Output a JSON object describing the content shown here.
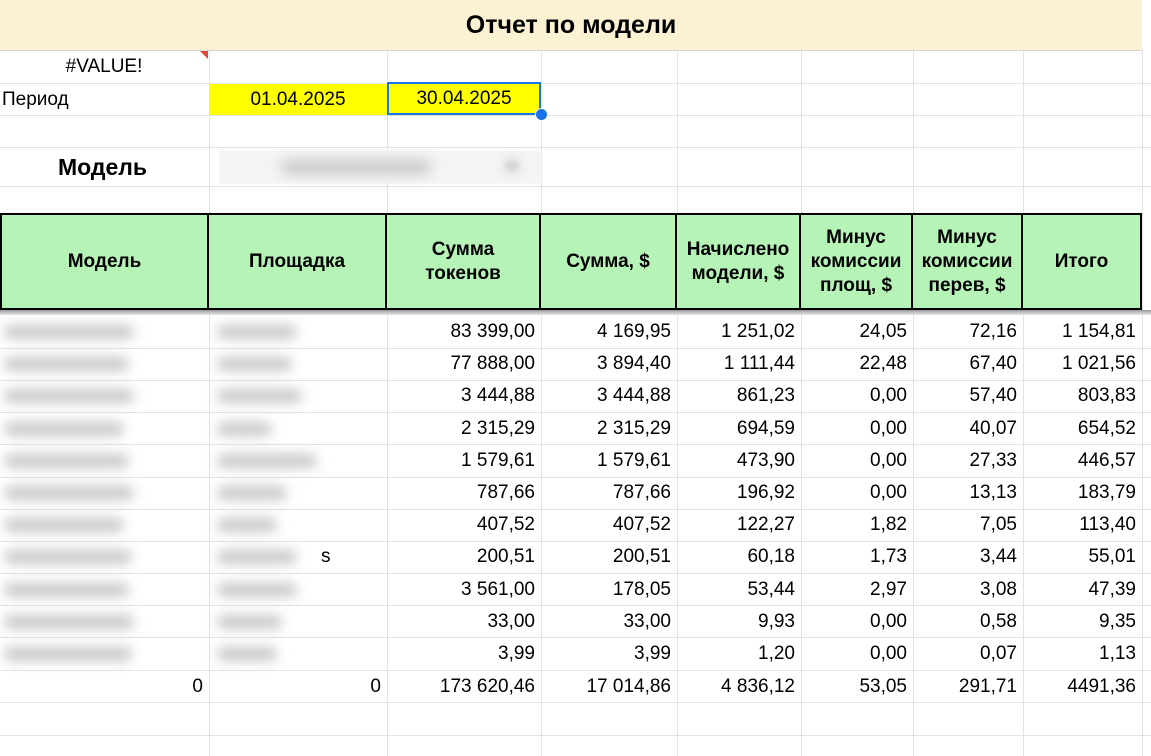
{
  "sheet": {
    "title": "Отчет по модели",
    "error_value": "#VALUE!",
    "period_label": "Период",
    "period_start": "01.04.2025",
    "period_end": "30.04.2025",
    "model_label": "Модель",
    "model_selector": "dropdown-blurred"
  },
  "table": {
    "headers": [
      "Модель",
      "Площадка",
      "Сумма\nтокенов",
      "Сумма, $",
      "Начислено\nмодели, $",
      "Минус\nкомиссии\nплощ, $",
      "Минус\nкомиссии\nперев, $",
      "Итого"
    ],
    "rows": [
      {
        "tokens": "83 399,00",
        "sum_usd": "4 169,95",
        "accrued": "1 251,02",
        "fee_platform": "24,05",
        "fee_transfer": "72,16",
        "total": "1 154,81"
      },
      {
        "tokens": "77 888,00",
        "sum_usd": "3 894,40",
        "accrued": "1 111,44",
        "fee_platform": "22,48",
        "fee_transfer": "67,40",
        "total": "1 021,56"
      },
      {
        "tokens": "3 444,88",
        "sum_usd": "3 444,88",
        "accrued": "861,23",
        "fee_platform": "0,00",
        "fee_transfer": "57,40",
        "total": "803,83"
      },
      {
        "tokens": "2 315,29",
        "sum_usd": "2 315,29",
        "accrued": "694,59",
        "fee_platform": "0,00",
        "fee_transfer": "40,07",
        "total": "654,52"
      },
      {
        "tokens": "1 579,61",
        "sum_usd": "1 579,61",
        "accrued": "473,90",
        "fee_platform": "0,00",
        "fee_transfer": "27,33",
        "total": "446,57"
      },
      {
        "tokens": "787,66",
        "sum_usd": "787,66",
        "accrued": "196,92",
        "fee_platform": "0,00",
        "fee_transfer": "13,13",
        "total": "183,79"
      },
      {
        "tokens": "407,52",
        "sum_usd": "407,52",
        "accrued": "122,27",
        "fee_platform": "1,82",
        "fee_transfer": "7,05",
        "total": "113,40"
      },
      {
        "tokens": "200,51",
        "sum_usd": "200,51",
        "accrued": "60,18",
        "fee_platform": "1,73",
        "fee_transfer": "3,44",
        "total": "55,01",
        "platform_suffix": "s"
      },
      {
        "tokens": "3 561,00",
        "sum_usd": "178,05",
        "accrued": "53,44",
        "fee_platform": "2,97",
        "fee_transfer": "3,08",
        "total": "47,39"
      },
      {
        "tokens": "33,00",
        "sum_usd": "33,00",
        "accrued": "9,93",
        "fee_platform": "0,00",
        "fee_transfer": "0,58",
        "total": "9,35"
      },
      {
        "tokens": "3,99",
        "sum_usd": "3,99",
        "accrued": "1,20",
        "fee_platform": "0,00",
        "fee_transfer": "0,07",
        "total": "1,13"
      }
    ],
    "totals": {
      "model": "0",
      "platform": "0",
      "tokens": "173 620,46",
      "sum_usd": "17 014,86",
      "accrued": "4 836,12",
      "fee_platform": "53,05",
      "fee_transfer": "291,71",
      "total": "4491,36"
    }
  },
  "colors": {
    "title_bg": "#fdf1d4",
    "header_bg": "#b6f3b6",
    "date_bg": "#ffff00",
    "selection": "#1a73e8",
    "error_marker": "#e0463a"
  }
}
